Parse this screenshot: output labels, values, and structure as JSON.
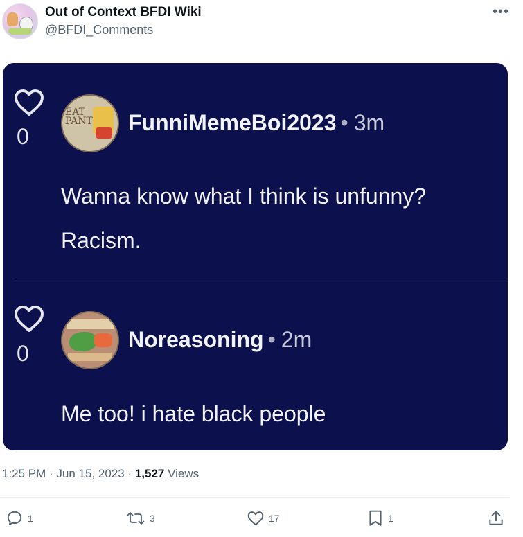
{
  "author": {
    "display_name": "Out of Context BFDI Wiki",
    "handle": "@BFDI_Comments"
  },
  "header": {
    "more_label": "•••"
  },
  "comments": [
    {
      "likes": "0",
      "username": "FunniMemeBoi2023",
      "separator": "•",
      "time": "3m",
      "lines": [
        "Wanna know what I think is unfunny?",
        "Racism."
      ]
    },
    {
      "likes": "0",
      "username": "Noreasoning",
      "separator": "•",
      "time": "2m",
      "lines": [
        "Me too! i hate black people"
      ]
    }
  ],
  "meta": {
    "time": "1:25 PM",
    "dot1": " · ",
    "date": "Jun 15, 2023",
    "dot2": " · ",
    "views_count": "1,527",
    "views_label": " Views"
  },
  "actions": {
    "replies": "1",
    "reposts": "3",
    "likes": "17",
    "bookmarks": "1"
  },
  "colors": {
    "card_background": "#0c104c",
    "secondary_text": "#536471"
  }
}
